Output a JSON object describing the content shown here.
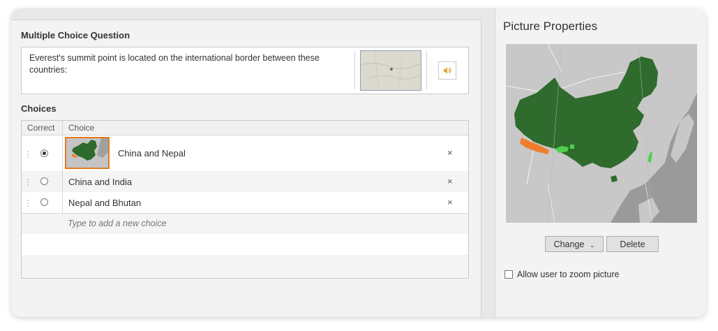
{
  "question": {
    "section_title": "Multiple Choice Question",
    "text": "Everest's summit point is located on the international border between these countries:",
    "thumbnail_icon": "map-thumbnail",
    "sound_icon": "speaker-icon"
  },
  "choices": {
    "section_title": "Choices",
    "col_correct": "Correct",
    "col_choice": "Choice",
    "items": [
      {
        "label": "China and Nepal",
        "correct": true,
        "has_image": true
      },
      {
        "label": "China and India",
        "correct": false,
        "has_image": false
      },
      {
        "label": "Nepal and Bhutan",
        "correct": false,
        "has_image": false
      }
    ],
    "delete_symbol": "×",
    "add_placeholder": "Type to add a new choice"
  },
  "properties": {
    "title": "Picture Properties",
    "change_label": "Change",
    "delete_label": "Delete",
    "zoom_label": "Allow user to zoom picture",
    "zoom_checked": false
  },
  "colors": {
    "china": "#2e6b2c",
    "nepal": "#f07d2a",
    "bhutan": "#4fcf4f",
    "land": "#c9c9c9",
    "sea": "#9a9a9a",
    "accent": "#e07b22"
  }
}
